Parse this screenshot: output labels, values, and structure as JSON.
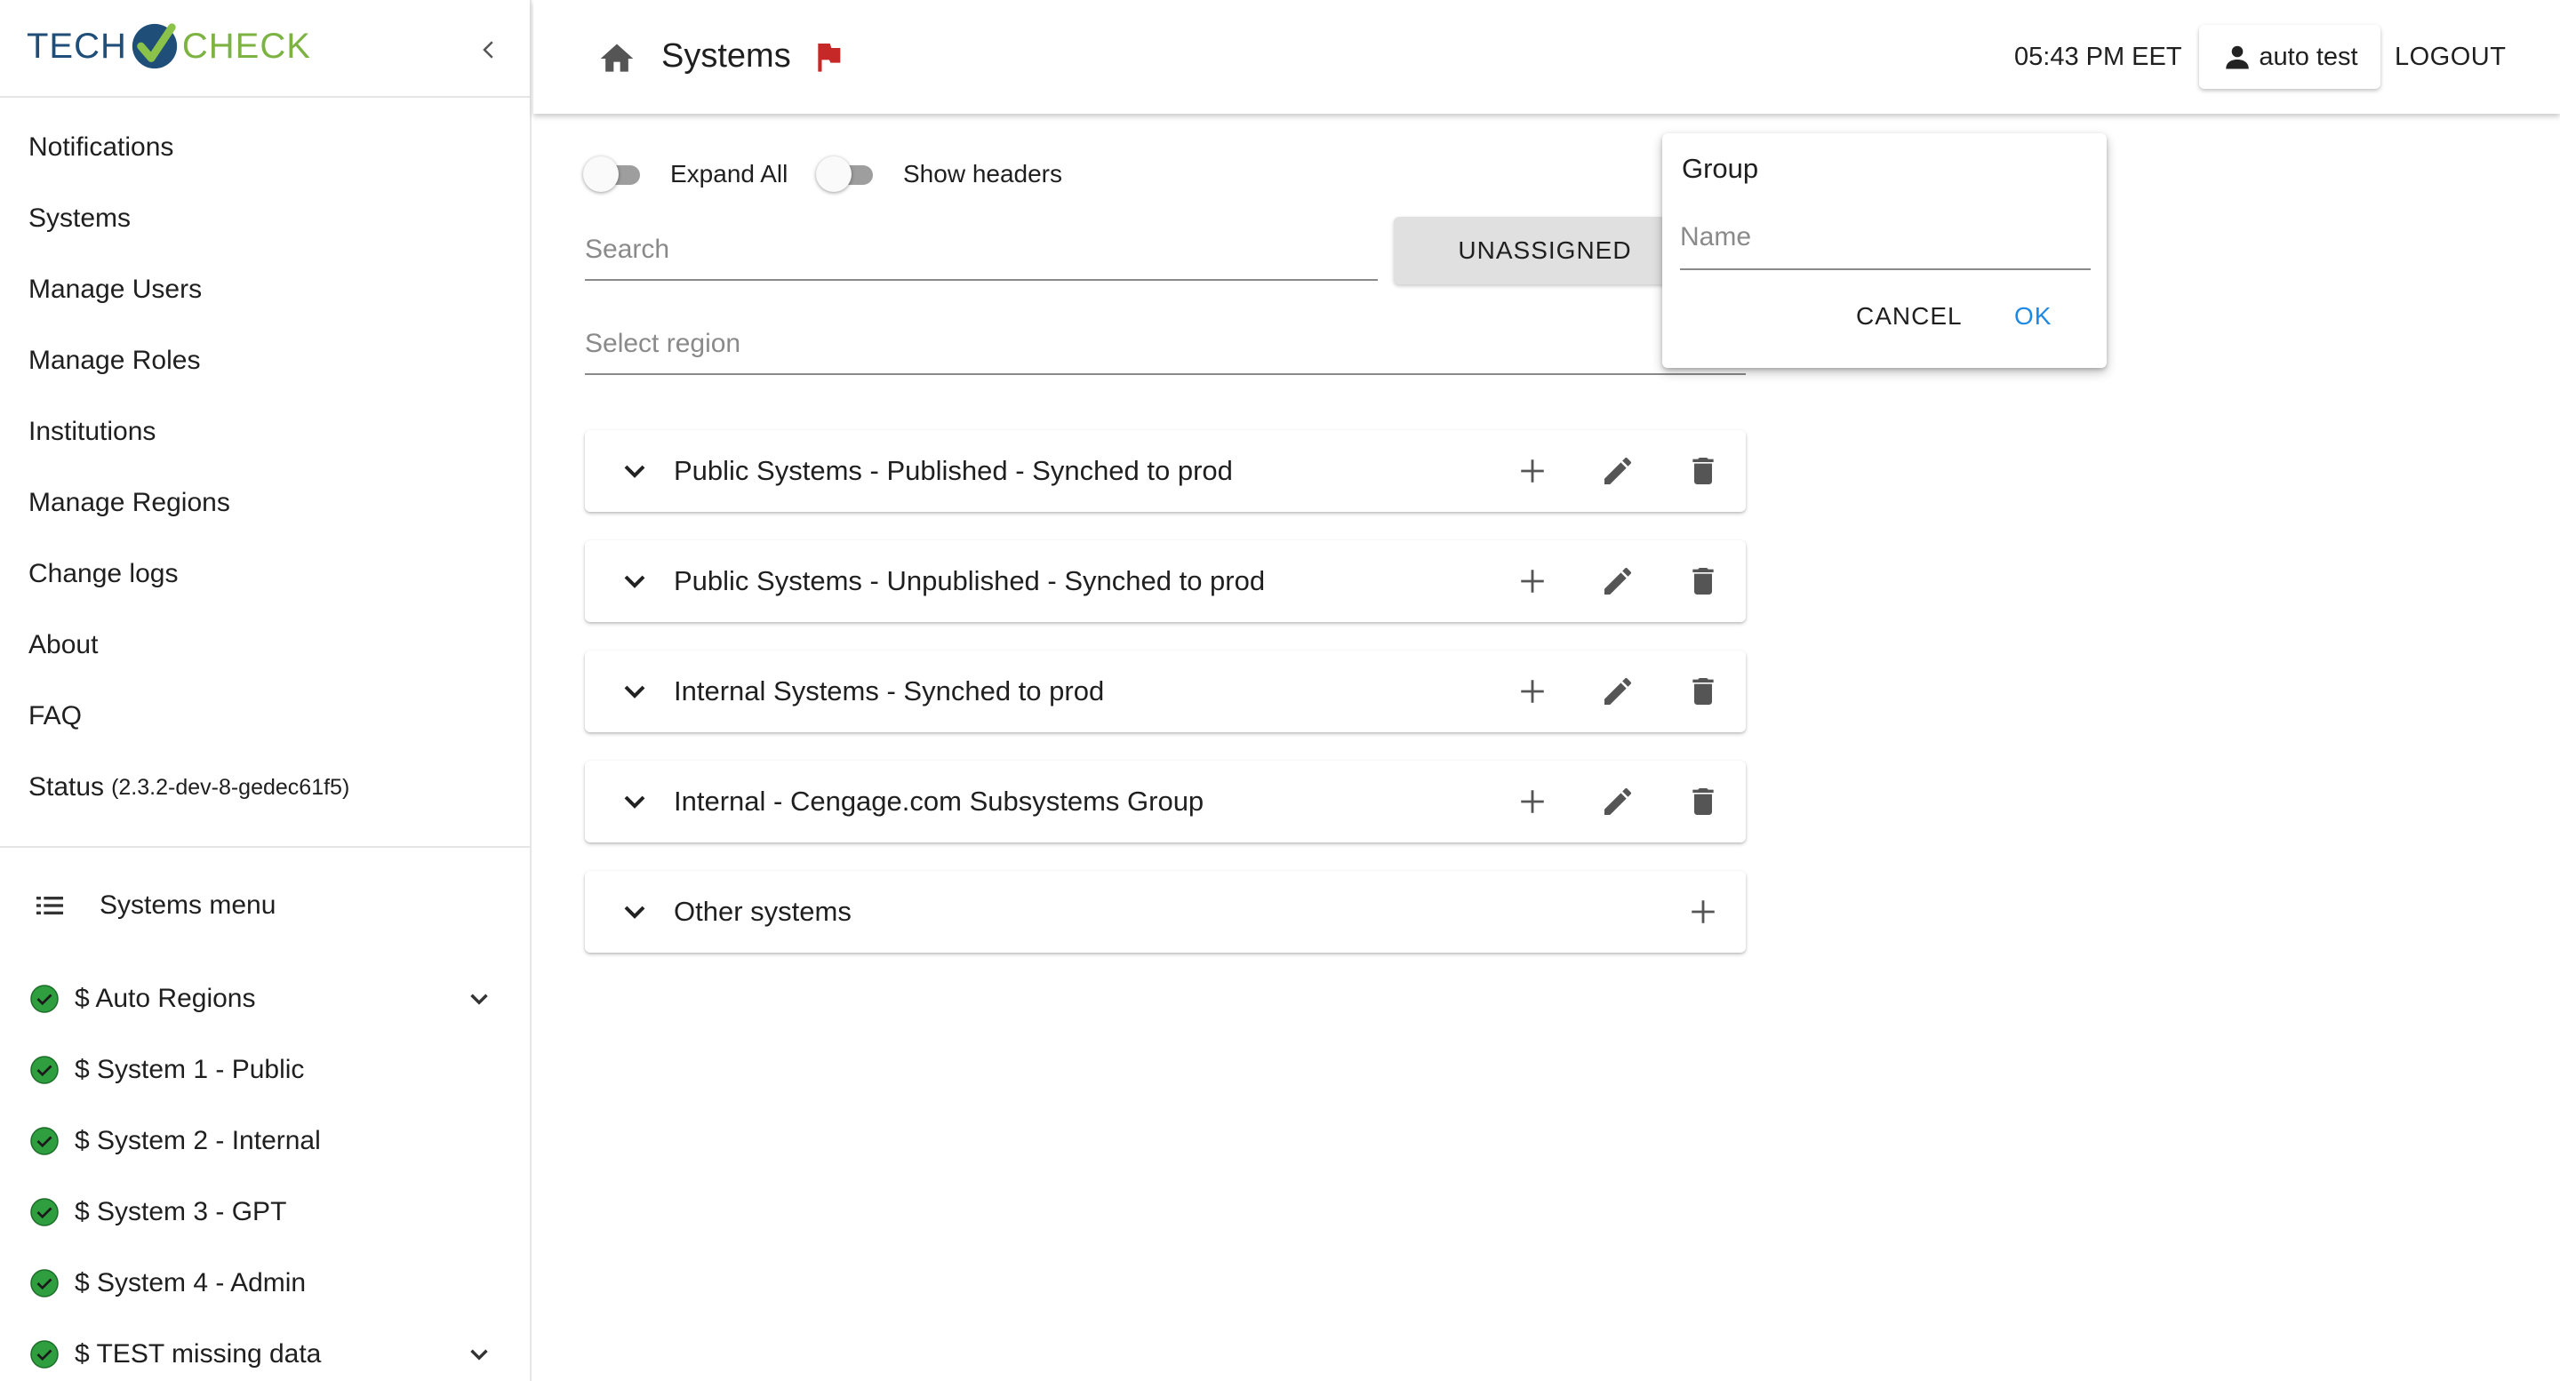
{
  "brand": {
    "name_part1": "TECH",
    "name_part2": "CHECK"
  },
  "sidebar": {
    "menu": [
      {
        "label": "Notifications"
      },
      {
        "label": "Systems"
      },
      {
        "label": "Manage Users"
      },
      {
        "label": "Manage Roles"
      },
      {
        "label": "Institutions"
      },
      {
        "label": "Manage Regions"
      },
      {
        "label": "Change logs"
      },
      {
        "label": "About"
      },
      {
        "label": "FAQ"
      }
    ],
    "status": {
      "label": "Status",
      "version": "(2.3.2-dev-8-gedec61f5)"
    },
    "systems_menu": {
      "title": "Systems menu",
      "items": [
        {
          "label": "$ Auto Regions",
          "expandable": true
        },
        {
          "label": "$ System 1 - Public",
          "expandable": false
        },
        {
          "label": "$ System 2 - Internal",
          "expandable": false
        },
        {
          "label": "$ System 3 - GPT",
          "expandable": false
        },
        {
          "label": "$ System 4 - Admin",
          "expandable": false
        },
        {
          "label": "$ TEST missing data",
          "expandable": true
        }
      ]
    }
  },
  "header": {
    "title": "Systems",
    "time": "05:43 PM EET",
    "user": "auto test",
    "logout": "LOGOUT"
  },
  "controls": {
    "expand_all": {
      "label": "Expand All",
      "on": false
    },
    "show_headers": {
      "label": "Show headers",
      "on": false
    },
    "search_placeholder": "Search",
    "unassigned_button": "UNASSIGNED",
    "region_placeholder": "Select region"
  },
  "groups": [
    {
      "label": "Public Systems - Published - Synched to prod"
    },
    {
      "label": "Public Systems - Unpublished - Synched to prod"
    },
    {
      "label": "Internal Systems - Synched to prod"
    },
    {
      "label": "Internal - Cengage.com Subsystems Group"
    },
    {
      "label": "Other systems"
    }
  ],
  "popover": {
    "title": "Group",
    "name_placeholder": "Name",
    "cancel": "CANCEL",
    "ok": "OK"
  },
  "colors": {
    "accent": "#1e88e5",
    "success": "#2e9e3e",
    "flag": "#c62828",
    "brand_dark": "#1f4e79",
    "brand_green": "#7cb342"
  }
}
